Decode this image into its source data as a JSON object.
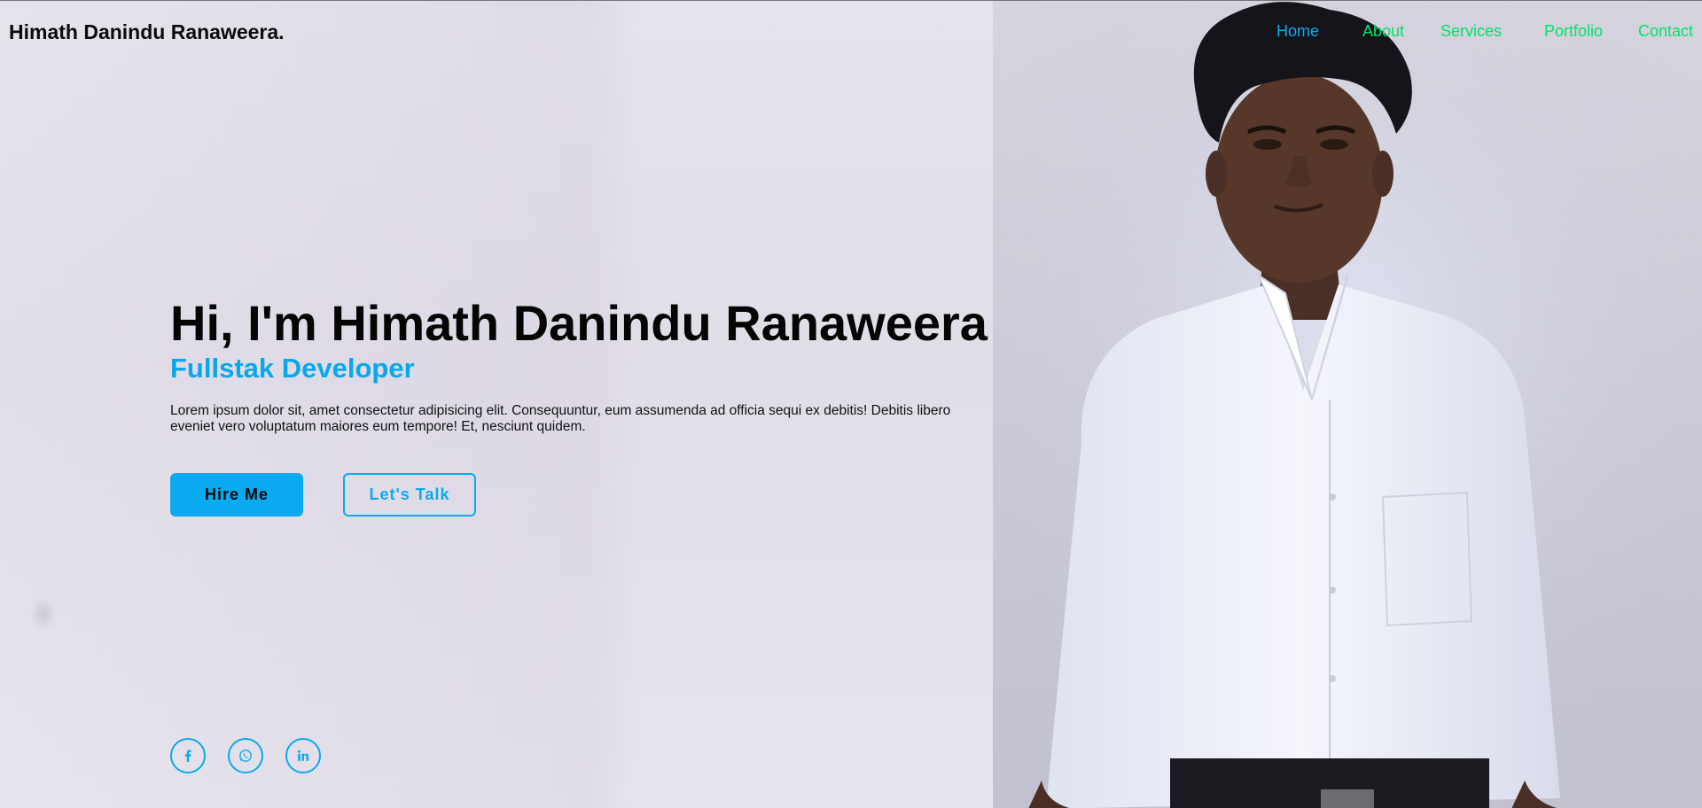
{
  "brand": {
    "logo_text": "Himath Danindu Ranaweera."
  },
  "nav": {
    "items": [
      {
        "label": "Home",
        "color": "#0aaaf0",
        "active": true
      },
      {
        "label": "About",
        "color": "#00e36a",
        "active": false
      },
      {
        "label": "Services",
        "color": "#00e36a",
        "active": false
      },
      {
        "label": "Portfolio",
        "color": "#00e36a",
        "active": false
      },
      {
        "label": "Contact",
        "color": "#00e36a",
        "active": false
      }
    ]
  },
  "hero": {
    "heading": "Hi, I'm Himath Danindu Ranaweera",
    "role": "Fullstak Developer",
    "description": "Lorem ipsum dolor sit, amet consectetur adipisicing elit. Consequuntur, eum assumenda ad officia sequi ex debitis! Debitis libero eveniet vero voluptatum maiores eum tempore! Et, nesciunt quidem.",
    "buttons": {
      "hire_label": "Hire Me",
      "talk_label": "Let's Talk"
    }
  },
  "social": {
    "icons": [
      "facebook-icon",
      "whatsapp-icon",
      "linkedin-icon"
    ]
  },
  "colors": {
    "accent": "#0aaaf0",
    "nav_inactive": "#00e36a",
    "text": "#050505"
  }
}
